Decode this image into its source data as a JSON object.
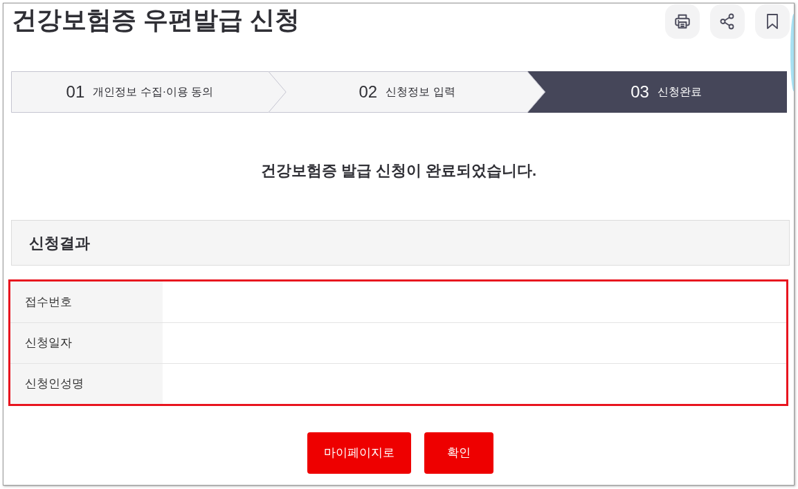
{
  "page": {
    "title": "건강보험증 우편발급 신청"
  },
  "steps": [
    {
      "number": "01",
      "label": "개인정보 수집·이용 동의",
      "selected": false
    },
    {
      "number": "02",
      "label": "신청정보 입력",
      "selected": false
    },
    {
      "number": "03",
      "label": "신청완료",
      "selected": true
    }
  ],
  "message": "건강보험증 발급 신청이 완료되었습니다.",
  "result": {
    "title": "신청결과",
    "rows": [
      {
        "label": "접수번호"
      },
      {
        "label": "신청일자"
      },
      {
        "label": "신청인성명"
      }
    ]
  },
  "buttons": [
    "마이페이지로",
    "확인"
  ]
}
